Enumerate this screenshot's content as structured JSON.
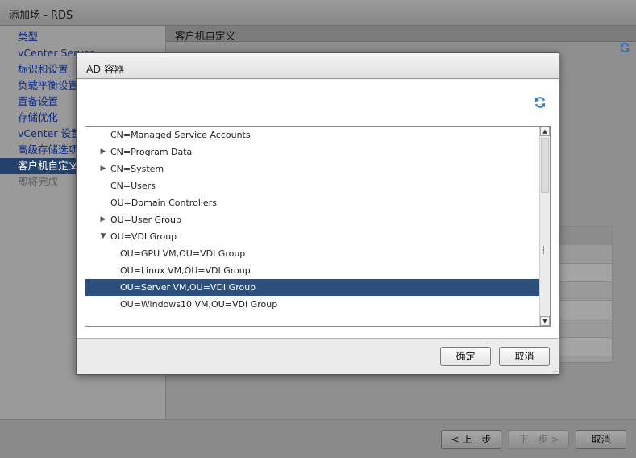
{
  "window": {
    "title": "添加场 - RDS"
  },
  "nav": {
    "items": [
      {
        "label": "类型",
        "state": "normal"
      },
      {
        "label": "vCenter Server",
        "state": "normal"
      },
      {
        "label": "标识和设置",
        "state": "normal"
      },
      {
        "label": "负载平衡设置",
        "state": "normal"
      },
      {
        "label": "置备设置",
        "state": "normal"
      },
      {
        "label": "存储优化",
        "state": "normal"
      },
      {
        "label": "vCenter 设置",
        "state": "normal"
      },
      {
        "label": "高级存储选项",
        "state": "normal"
      },
      {
        "label": "客户机自定义",
        "state": "active"
      },
      {
        "label": "即将完成",
        "state": "disabled"
      }
    ]
  },
  "content": {
    "header": "客户机自定义",
    "refresh_icon": "refresh-icon"
  },
  "footer": {
    "back": "< 上一步",
    "next": "下一步 >",
    "cancel": "取消"
  },
  "dialog": {
    "title": "AD 容器",
    "refresh_icon": "refresh-icon",
    "tree": [
      {
        "label": "CN=Managed Service Accounts",
        "level": 0,
        "expander": "none"
      },
      {
        "label": "CN=Program Data",
        "level": 0,
        "expander": "collapsed"
      },
      {
        "label": "CN=System",
        "level": 0,
        "expander": "collapsed"
      },
      {
        "label": "CN=Users",
        "level": 0,
        "expander": "none"
      },
      {
        "label": "OU=Domain Controllers",
        "level": 0,
        "expander": "none"
      },
      {
        "label": "OU=User Group",
        "level": 0,
        "expander": "collapsed"
      },
      {
        "label": "OU=VDI Group",
        "level": 0,
        "expander": "expanded"
      },
      {
        "label": "OU=GPU VM,OU=VDI Group",
        "level": 1,
        "expander": "none"
      },
      {
        "label": "OU=Linux VM,OU=VDI Group",
        "level": 1,
        "expander": "none"
      },
      {
        "label": "OU=Server VM,OU=VDI Group",
        "level": 1,
        "expander": "none",
        "selected": true
      },
      {
        "label": "OU=Windows10 VM,OU=VDI Group",
        "level": 1,
        "expander": "none"
      }
    ],
    "ok": "确定",
    "cancel": "取消"
  },
  "colors": {
    "selection": "#2b4e7b",
    "nav_active": "#23416a",
    "link": "#0a2a8c"
  }
}
